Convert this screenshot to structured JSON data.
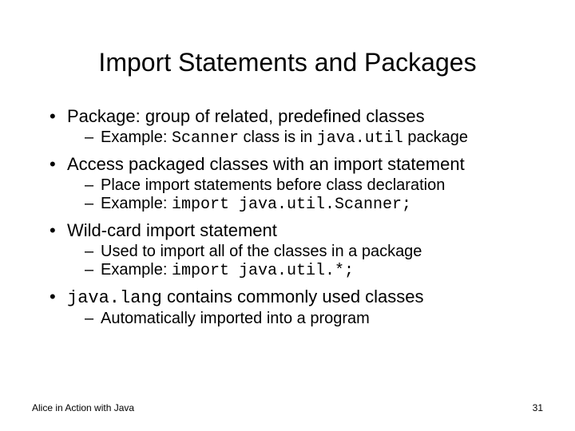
{
  "title": "Import Statements and Packages",
  "bullets": [
    {
      "text_pre": "Package: group of related, predefined classes",
      "subs": [
        {
          "pre": "Example: ",
          "code1": "Scanner",
          "mid": " class is in ",
          "code2": "java.util",
          "post": " package"
        }
      ]
    },
    {
      "text_pre": "Access packaged classes with an import statement",
      "subs": [
        {
          "pre": "Place import statements before class declaration"
        },
        {
          "pre": "Example: ",
          "code1": "import java.util.Scanner;"
        }
      ]
    },
    {
      "text_pre": "Wild-card import statement",
      "subs": [
        {
          "pre": "Used to import all of the classes in a package"
        },
        {
          "pre": "Example: ",
          "code1": "import java.util.*;"
        }
      ]
    },
    {
      "code_first": "java.lang",
      "text_post": " contains commonly used classes",
      "subs": [
        {
          "pre": "Automatically imported into a program"
        }
      ]
    }
  ],
  "footer": {
    "left": "Alice in Action with Java",
    "right": "31"
  }
}
